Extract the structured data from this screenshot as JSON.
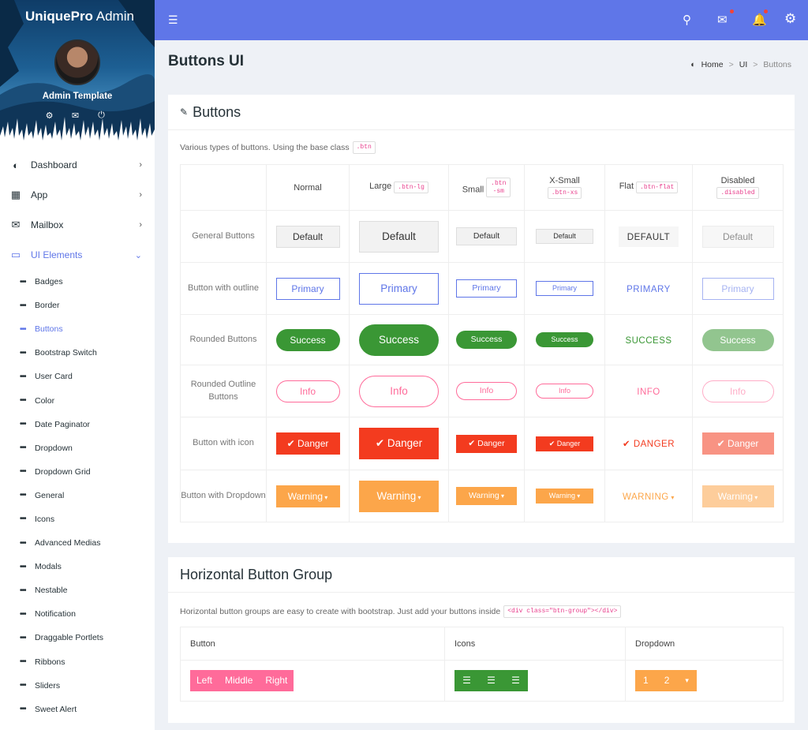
{
  "app": {
    "brand_bold": "UniquePro",
    "brand_light": "Admin",
    "user_name": "Admin Template"
  },
  "sidebar": {
    "main": [
      {
        "label": "Dashboard"
      },
      {
        "label": "App"
      },
      {
        "label": "Mailbox"
      },
      {
        "label": "UI Elements"
      }
    ],
    "sub": [
      "Badges",
      "Border",
      "Buttons",
      "Bootstrap Switch",
      "User Card",
      "Color",
      "Date Paginator",
      "Dropdown",
      "Dropdown Grid",
      "General",
      "Icons",
      "Advanced Medias",
      "Modals",
      "Nestable",
      "Notification",
      "Draggable Portlets",
      "Ribbons",
      "Sliders",
      "Sweet Alert"
    ]
  },
  "page": {
    "title": "Buttons UI"
  },
  "breadcrumb": [
    "Home",
    "UI",
    "Buttons"
  ],
  "card1": {
    "title": "Buttons",
    "desc": "Various types of buttons. Using the base class",
    "desc_code": ".btn",
    "headers": [
      {
        "label": "Normal",
        "code": ""
      },
      {
        "label": "Large",
        "code": ".btn-lg"
      },
      {
        "label": "Small",
        "code": ".btn-sm"
      },
      {
        "label": "X-Small",
        "code": ".btn-xs"
      },
      {
        "label": "Flat",
        "code": ".btn-flat"
      },
      {
        "label": "Disabled",
        "code": ".disabled"
      }
    ],
    "rows": [
      {
        "label": "General Buttons",
        "text": "Default",
        "flat": "DEFAULT"
      },
      {
        "label": "Button with outline",
        "text": "Primary",
        "flat": "PRIMARY"
      },
      {
        "label": "Rounded Buttons",
        "text": "Success",
        "flat": "SUCCESS"
      },
      {
        "label": "Rounded Outline Buttons",
        "text": "Info",
        "flat": "INFO"
      },
      {
        "label": "Button with icon",
        "text": "Danger",
        "flat": "DANGER"
      },
      {
        "label": "Button with Dropdown",
        "text": "Warning",
        "flat": "WARNING"
      }
    ]
  },
  "card2": {
    "title": "Horizontal Button Group",
    "desc": "Horizontal button groups are easy to create with bootstrap. Just add your buttons inside",
    "desc_code": "<div class=\"btn-group\"></div>",
    "headers": [
      "Button",
      "Icons",
      "Dropdown"
    ],
    "group1": [
      "Left",
      "Middle",
      "Right"
    ],
    "group3": [
      "1",
      "2"
    ]
  },
  "icons": {
    "menu": "menu-icon",
    "search": "search-icon",
    "mail": "mail-icon",
    "bell": "bell-icon",
    "settings": "gear-icon"
  },
  "colors": {
    "accent": "#5f76e8",
    "success": "#3a9735",
    "info": "#ff6b9a",
    "danger": "#f33b1f",
    "warning": "#fca64a"
  }
}
